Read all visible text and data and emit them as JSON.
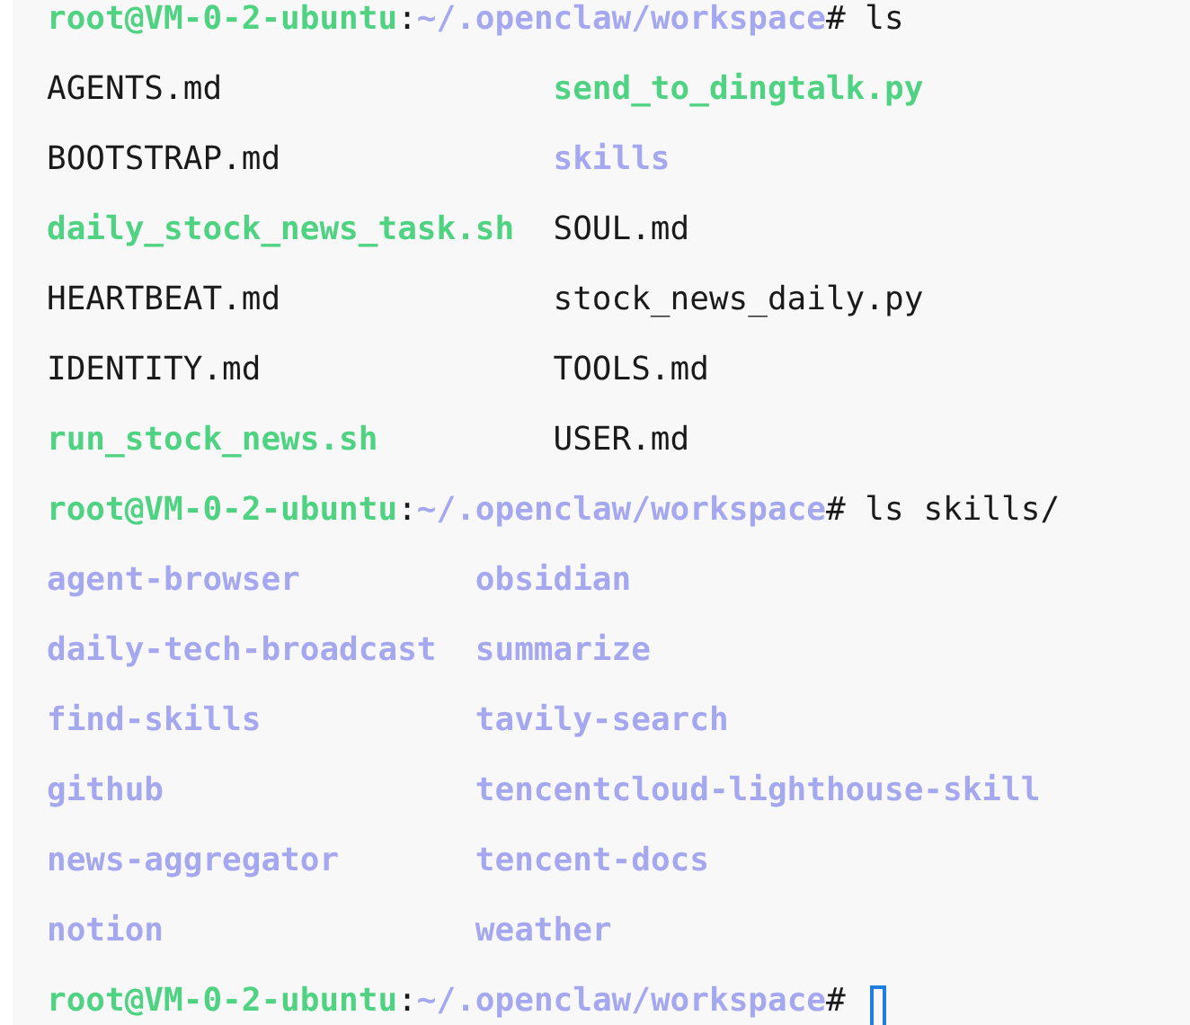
{
  "lines": [
    {
      "kind": "prompt",
      "user_host": "root@VM-0-2-ubuntu",
      "separator": ":",
      "path": "~/.openclaw/workspace",
      "symbol": "#",
      "command": " ls",
      "cursor": false
    },
    {
      "kind": "listing",
      "rows": [
        [
          {
            "text": "AGENTS.md",
            "kind": "file"
          },
          {
            "text": "send_to_dingtalk.py",
            "kind": "exec"
          }
        ],
        [
          {
            "text": "BOOTSTRAP.md",
            "kind": "file"
          },
          {
            "text": "skills",
            "kind": "dir"
          }
        ],
        [
          {
            "text": "daily_stock_news_task.sh",
            "kind": "exec"
          },
          {
            "text": "SOUL.md",
            "kind": "file"
          }
        ],
        [
          {
            "text": "HEARTBEAT.md",
            "kind": "file"
          },
          {
            "text": "stock_news_daily.py",
            "kind": "file"
          }
        ],
        [
          {
            "text": "IDENTITY.md",
            "kind": "file"
          },
          {
            "text": "TOOLS.md",
            "kind": "file"
          }
        ],
        [
          {
            "text": "run_stock_news.sh",
            "kind": "exec"
          },
          {
            "text": "USER.md",
            "kind": "file"
          }
        ]
      ]
    },
    {
      "kind": "prompt",
      "user_host": "root@VM-0-2-ubuntu",
      "separator": ":",
      "path": "~/.openclaw/workspace",
      "symbol": "#",
      "command": " ls skills/",
      "cursor": false
    },
    {
      "kind": "listing",
      "rows": [
        [
          {
            "text": "agent-browser",
            "kind": "dir"
          },
          {
            "text": "obsidian",
            "kind": "dir"
          }
        ],
        [
          {
            "text": "daily-tech-broadcast",
            "kind": "dir"
          },
          {
            "text": "summarize",
            "kind": "dir"
          }
        ],
        [
          {
            "text": "find-skills",
            "kind": "dir"
          },
          {
            "text": "tavily-search",
            "kind": "dir"
          }
        ],
        [
          {
            "text": "github",
            "kind": "dir"
          },
          {
            "text": "tencentcloud-lighthouse-skill",
            "kind": "dir"
          }
        ],
        [
          {
            "text": "news-aggregator",
            "kind": "dir"
          },
          {
            "text": "tencent-docs",
            "kind": "dir"
          }
        ],
        [
          {
            "text": "notion",
            "kind": "dir"
          },
          {
            "text": "weather",
            "kind": "dir"
          }
        ]
      ]
    },
    {
      "kind": "prompt",
      "user_host": "root@VM-0-2-ubuntu",
      "separator": ":",
      "path": "~/.openclaw/workspace",
      "symbol": "#",
      "cursor": true
    }
  ]
}
